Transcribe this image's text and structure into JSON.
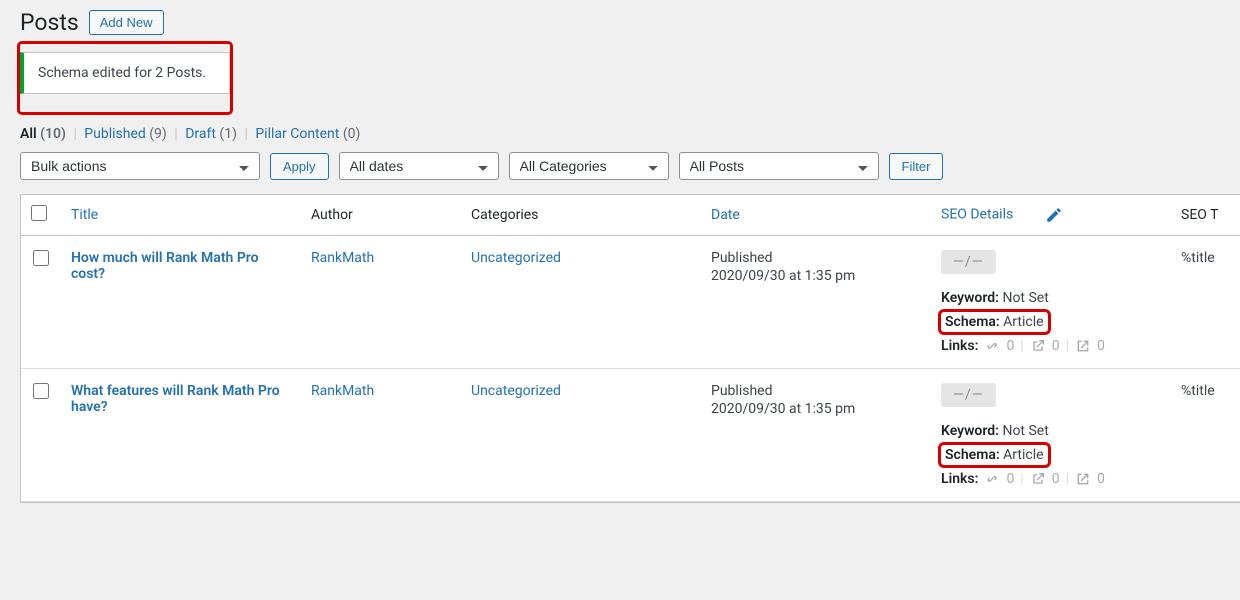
{
  "header": {
    "title": "Posts",
    "add_new": "Add New"
  },
  "notice": "Schema edited for 2 Posts.",
  "tabs": {
    "all": {
      "label": "All",
      "count": "(10)"
    },
    "pub": {
      "label": "Published",
      "count": "(9)"
    },
    "draft": {
      "label": "Draft",
      "count": "(1)"
    },
    "pillar": {
      "label": "Pillar Content",
      "count": "(0)"
    }
  },
  "filters": {
    "bulk_label": "Bulk actions",
    "apply": "Apply",
    "dates": "All dates",
    "categories": "All Categories",
    "posts": "All Posts",
    "filter": "Filter"
  },
  "columns": {
    "title": "Title",
    "author": "Author",
    "categories": "Categories",
    "date": "Date",
    "seo_details": "SEO Details",
    "seo_t": "SEO T"
  },
  "rows": [
    {
      "title": "How much will Rank Math Pro cost?",
      "author": "RankMath",
      "categories": "Uncategorized",
      "date_status": "Published",
      "date_value": "2020/09/30 at 1:35 pm",
      "seo_badge": "—/—",
      "keyword_label": "Keyword:",
      "keyword_value": "Not Set",
      "schema_label": "Schema:",
      "schema_value": "Article",
      "links_label": "Links:",
      "links_int": "0",
      "links_ext": "0",
      "links_in": "0",
      "seo_t": "%title"
    },
    {
      "title": "What features will Rank Math Pro have?",
      "author": "RankMath",
      "categories": "Uncategorized",
      "date_status": "Published",
      "date_value": "2020/09/30 at 1:35 pm",
      "seo_badge": "—/—",
      "keyword_label": "Keyword:",
      "keyword_value": "Not Set",
      "schema_label": "Schema:",
      "schema_value": "Article",
      "links_label": "Links:",
      "links_int": "0",
      "links_ext": "0",
      "links_in": "0",
      "seo_t": "%title"
    }
  ]
}
